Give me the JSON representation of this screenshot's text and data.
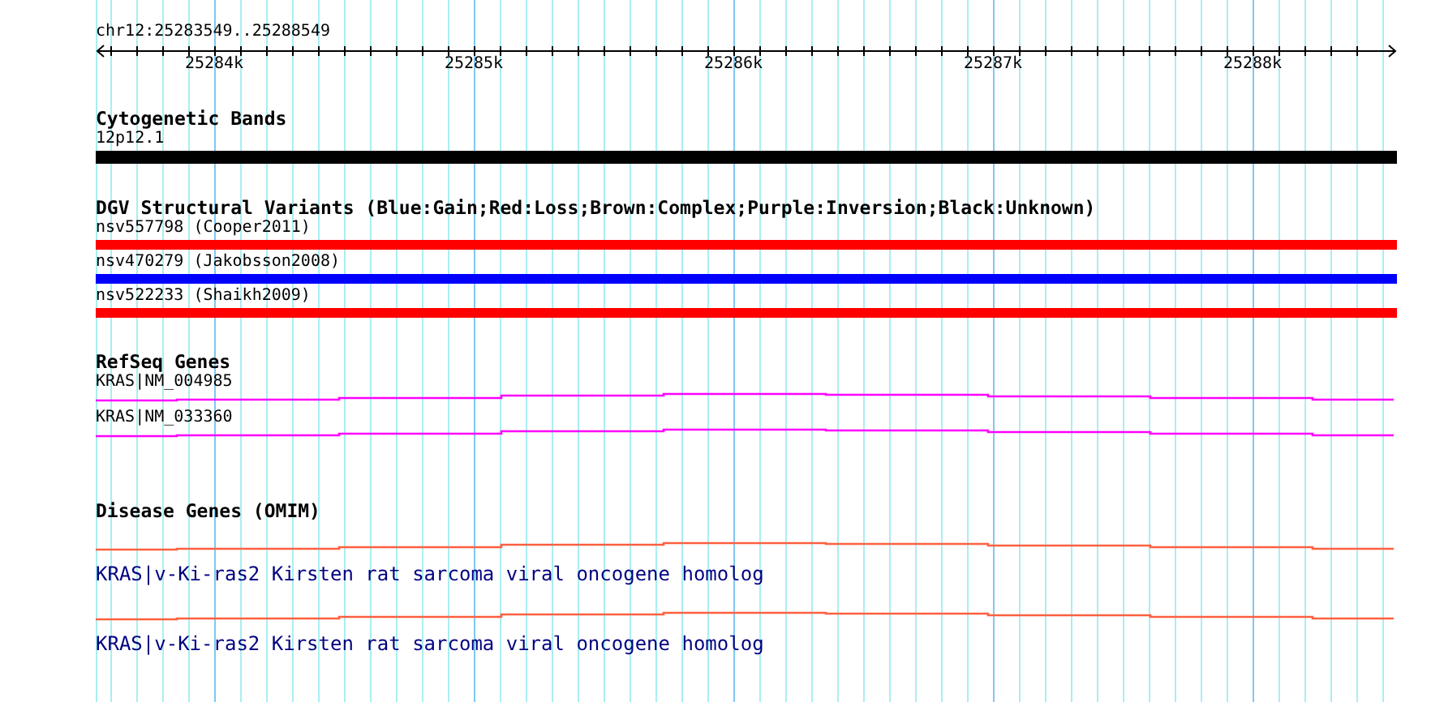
{
  "location": "chr12:25283549..25288549",
  "ruler": {
    "ticks": [
      "25284k",
      "25285k",
      "25286k",
      "25287k",
      "25288k"
    ]
  },
  "tracks": [
    {
      "kind": "band",
      "title": "Cytogenetic Bands",
      "features": [
        {
          "label": "12p12.1",
          "color": "#000000"
        }
      ]
    },
    {
      "kind": "variant",
      "title": "DGV Structural Variants (Blue:Gain;Red:Loss;Brown:Complex;Purple:Inversion;Black:Unknown)",
      "features": [
        {
          "label": "nsv557798 (Cooper2011)",
          "color": "#ff0000"
        },
        {
          "label": "nsv470279 (Jakobsson2008)",
          "color": "#0000ff"
        },
        {
          "label": "nsv522233 (Shaikh2009)",
          "color": "#ff0000"
        }
      ]
    },
    {
      "kind": "gene",
      "title": "RefSeq Genes",
      "features": [
        {
          "label": "KRAS|NM_004985",
          "color": "#ff00ff"
        },
        {
          "label": "KRAS|NM_033360",
          "color": "#ff00ff"
        }
      ]
    },
    {
      "kind": "disease",
      "title": "Disease Genes (OMIM)",
      "features": [
        {
          "label": "KRAS|v-Ki-ras2 Kirsten rat sarcoma viral oncogene homolog",
          "color": "#ff6040"
        },
        {
          "label": "KRAS|v-Ki-ras2 Kirsten rat sarcoma viral oncogene homolog",
          "color": "#ff6040"
        }
      ]
    }
  ]
}
